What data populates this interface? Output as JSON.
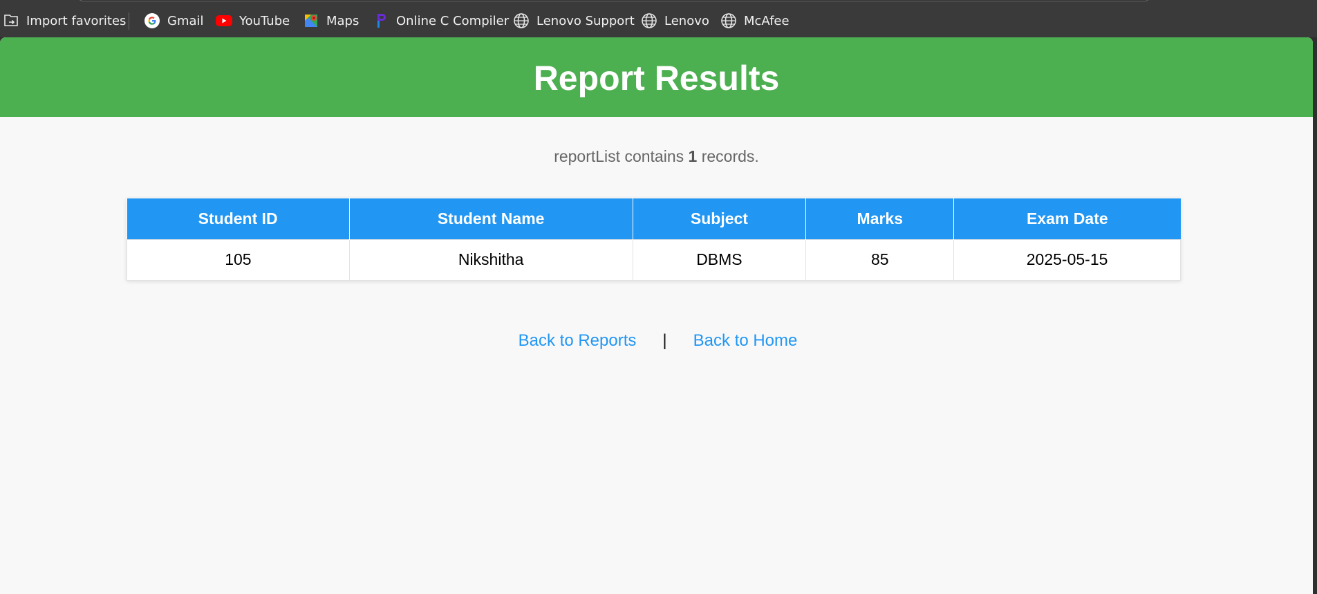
{
  "browser": {
    "favorites": [
      {
        "label": "Import favorites",
        "icon": "import-favorites-icon"
      },
      {
        "label": "Gmail",
        "icon": "google-icon"
      },
      {
        "label": "YouTube",
        "icon": "youtube-icon"
      },
      {
        "label": "Maps",
        "icon": "maps-icon"
      },
      {
        "label": "Online C Compiler",
        "icon": "compiler-icon"
      },
      {
        "label": "Lenovo Support",
        "icon": "globe-icon"
      },
      {
        "label": "Lenovo",
        "icon": "globe-icon"
      },
      {
        "label": "McAfee",
        "icon": "globe-icon"
      }
    ]
  },
  "page": {
    "title": "Report Results",
    "summary_prefix": "reportList contains",
    "summary_count": "1",
    "summary_suffix": "records.",
    "colors": {
      "header_bg": "#4caf50",
      "table_header_bg": "#2196f3",
      "link": "#2196f3"
    }
  },
  "table": {
    "headers": [
      "Student ID",
      "Student Name",
      "Subject",
      "Marks",
      "Exam Date"
    ],
    "rows": [
      [
        "105",
        "Nikshitha",
        "DBMS",
        "85",
        "2025-05-15"
      ]
    ]
  },
  "links": {
    "back_reports": "Back to Reports",
    "separator": "|",
    "back_home": "Back to Home"
  }
}
